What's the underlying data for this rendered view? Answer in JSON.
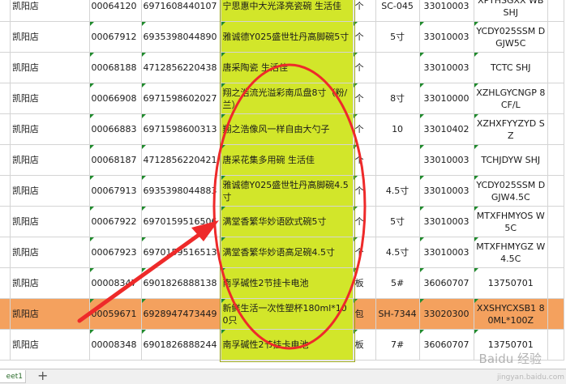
{
  "rows": [
    {
      "store": "凯阳店",
      "code": "00064120",
      "barcode": "6971608440107",
      "name": "宁思惠中大光泽亮瓷碗 生活佳",
      "unit": "个",
      "spec": "SC-045",
      "category": "33010003",
      "pinyin": "XPYHSGXX WB SHJ",
      "highlight": false
    },
    {
      "store": "凯阳店",
      "code": "00067912",
      "barcode": "6935398044890",
      "name": "雅诚德Y025盛世牡丹高脚碗5寸",
      "unit": "个",
      "spec": "5寸",
      "category": "33010003",
      "pinyin": "YCDY025SSM DGJW5C",
      "highlight": false
    },
    {
      "store": "凯阳店",
      "code": "00068188",
      "barcode": "4712856220438",
      "name": "唐采陶瓷  生活佳",
      "unit": "个",
      "spec": "",
      "category": "33010003",
      "pinyin": "TCTC  SHJ",
      "highlight": false
    },
    {
      "store": "凯阳店",
      "code": "00066908",
      "barcode": "6971598602027",
      "name": "翔之浩流光溢彩南瓜盘8寸（粉/兰）",
      "unit": "个",
      "spec": "8寸",
      "category": "33010000",
      "pinyin": "XZHLGYCNGP 8CF/L",
      "highlight": false
    },
    {
      "store": "凯阳店",
      "code": "00066883",
      "barcode": "6971598600313",
      "name": "翔之浩像风一样自由大勺子",
      "unit": "个",
      "spec": "10",
      "category": "33010402",
      "pinyin": "XZHXFYYZYD SZ",
      "highlight": false
    },
    {
      "store": "凯阳店",
      "code": "00068187",
      "barcode": "4712856220421",
      "name": "唐采花集多用碗  生活佳",
      "unit": "个",
      "spec": "",
      "category": "33010003",
      "pinyin": "TCHJDYW SHJ",
      "highlight": false
    },
    {
      "store": "凯阳店",
      "code": "00067913",
      "barcode": "6935398044883",
      "name": "雅诚德Y025盛世牡丹高脚碗4.5寸",
      "unit": "个",
      "spec": "4.5寸",
      "category": "33010003",
      "pinyin": "YCDY025SSM DGJW4.5C",
      "highlight": false
    },
    {
      "store": "凯阳店",
      "code": "00067922",
      "barcode": "6970159516506",
      "name": "满堂香繁华妙语欧式碗5寸",
      "unit": "个",
      "spec": "5寸",
      "category": "33010003",
      "pinyin": "MTXFHMYOS W5C",
      "highlight": false
    },
    {
      "store": "凯阳店",
      "code": "00067923",
      "barcode": "6970159516513",
      "name": "满堂香繁华妙语高足碗4.5寸",
      "unit": "个",
      "spec": "4.5寸",
      "category": "33010003",
      "pinyin": "MTXFHMYGZ W4.5C",
      "highlight": false
    },
    {
      "store": "凯阳店",
      "code": "00008347",
      "barcode": "6901826888138",
      "name": "南孚碱性2节挂卡电池",
      "unit": "板",
      "spec": "5#",
      "category": "36060707",
      "pinyin": "13750701",
      "highlight": false
    },
    {
      "store": "凯阳店",
      "code": "00059671",
      "barcode": "6928947473449",
      "name": "新鲜生活一次性塑杯180ml*100只",
      "unit": "包",
      "spec": "SH-7344",
      "category": "33020300",
      "pinyin": "XXSHYCXSB1 80ML*100Z",
      "highlight": true
    },
    {
      "store": "凯阳店",
      "code": "00008348",
      "barcode": "6901826888244",
      "name": "南孚碱性2节挂卡电池",
      "unit": "板",
      "spec": "7#",
      "category": "36060707",
      "pinyin": "13750701",
      "highlight": false
    }
  ],
  "sheet_tab": "eet1",
  "add_sheet_glyph": "+",
  "watermark": "Baidu 经验",
  "watermark_sub": "jingyan.baidu.com",
  "colors": {
    "highlight_column": "#d2e62a",
    "highlight_row": "#f4a15e",
    "annotation": "#ee2a2a"
  }
}
